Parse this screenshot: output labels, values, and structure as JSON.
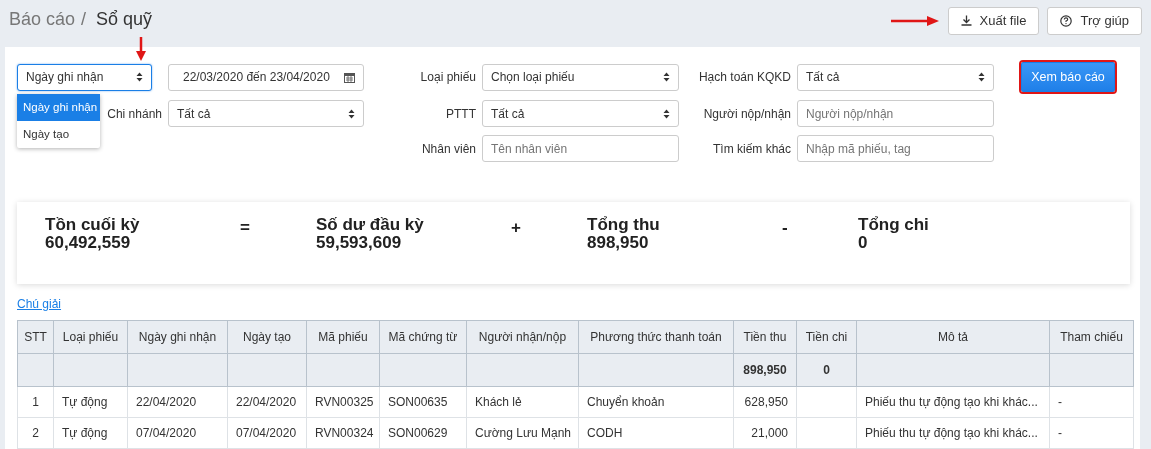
{
  "breadcrumb": {
    "parent": "Báo cáo",
    "separator": "/",
    "current": "Sổ quỹ"
  },
  "header_buttons": [
    {
      "label": "Xuất file",
      "kind": "download",
      "arrow_marker": true
    },
    {
      "label": "Trợ giúp",
      "kind": "help",
      "arrow_marker": false
    }
  ],
  "filters": {
    "date_type": {
      "value": "Ngày ghi nhận",
      "expanded": true,
      "arrow_marker": true,
      "options": [
        {
          "label": "Ngày ghi nhận",
          "selected": true
        },
        {
          "label": "Ngày tạo",
          "selected": false
        }
      ]
    },
    "date_range": "22/03/2020 đến 23/04/2020",
    "branch": {
      "label": "Chi nhánh",
      "value": "Tất cả"
    },
    "fields": [
      {
        "label": "Loại phiếu",
        "kind": "select",
        "value": "Chọn loại phiếu"
      },
      {
        "label": "Hạch toán KQKD",
        "kind": "select",
        "value": "Tất cả"
      },
      {
        "label": "PTTT",
        "kind": "select",
        "value": "Tất cả"
      },
      {
        "label": "Người nộp/nhận",
        "kind": "input",
        "placeholder": "Người nộp/nhận"
      },
      {
        "label": "Nhân viên",
        "kind": "input",
        "placeholder": "Tên nhân viên"
      },
      {
        "label": "Tìm kiếm khác",
        "kind": "input",
        "placeholder": "Nhập mã phiếu, tag"
      }
    ],
    "submit": {
      "label": "Xem báo cáo",
      "highlighted": true
    }
  },
  "summary": [
    {
      "kind": "metric",
      "label": "Tồn cuối kỳ",
      "value": "60,492,559"
    },
    {
      "kind": "operator",
      "symbol": "="
    },
    {
      "kind": "metric",
      "label": "Số dư đầu kỳ",
      "value": "59,593,609"
    },
    {
      "kind": "operator",
      "symbol": "+"
    },
    {
      "kind": "metric",
      "label": "Tổng thu",
      "value": "898,950"
    },
    {
      "kind": "operator",
      "symbol": "-"
    },
    {
      "kind": "metric",
      "label": "Tổng chi",
      "value": "0"
    }
  ],
  "legend_link": "Chú giải",
  "table": {
    "columns": [
      {
        "label": "STT",
        "kind": "index"
      },
      {
        "label": "Loại phiếu",
        "kind": "text"
      },
      {
        "label": "Ngày ghi nhận",
        "kind": "text"
      },
      {
        "label": "Ngày tạo",
        "kind": "text"
      },
      {
        "label": "Mã phiếu",
        "kind": "text"
      },
      {
        "label": "Mã chứng từ",
        "kind": "text"
      },
      {
        "label": "Người nhận/nộp",
        "kind": "text"
      },
      {
        "label": "Phương thức thanh toán",
        "kind": "text"
      },
      {
        "label": "Tiền thu",
        "kind": "number",
        "total": "898,950"
      },
      {
        "label": "Tiền chi",
        "kind": "number",
        "total": "0"
      },
      {
        "label": "Mô tả",
        "kind": "text"
      },
      {
        "label": "Tham chiếu",
        "kind": "text"
      }
    ],
    "rows": [
      [
        "1",
        "Tự động",
        "22/04/2020",
        "22/04/2020",
        "RVN00325",
        "SON00635",
        "Khách lẻ",
        "Chuyển khoản",
        "628,950",
        "",
        "Phiếu thu tự động tạo khi khác...",
        "-"
      ],
      [
        "2",
        "Tự động",
        "07/04/2020",
        "07/04/2020",
        "RVN00324",
        "SON00629",
        "Cường Lưu Mạnh",
        "CODH",
        "21,000",
        "",
        "Phiếu thu tự động tạo khi khác...",
        "-"
      ]
    ]
  }
}
